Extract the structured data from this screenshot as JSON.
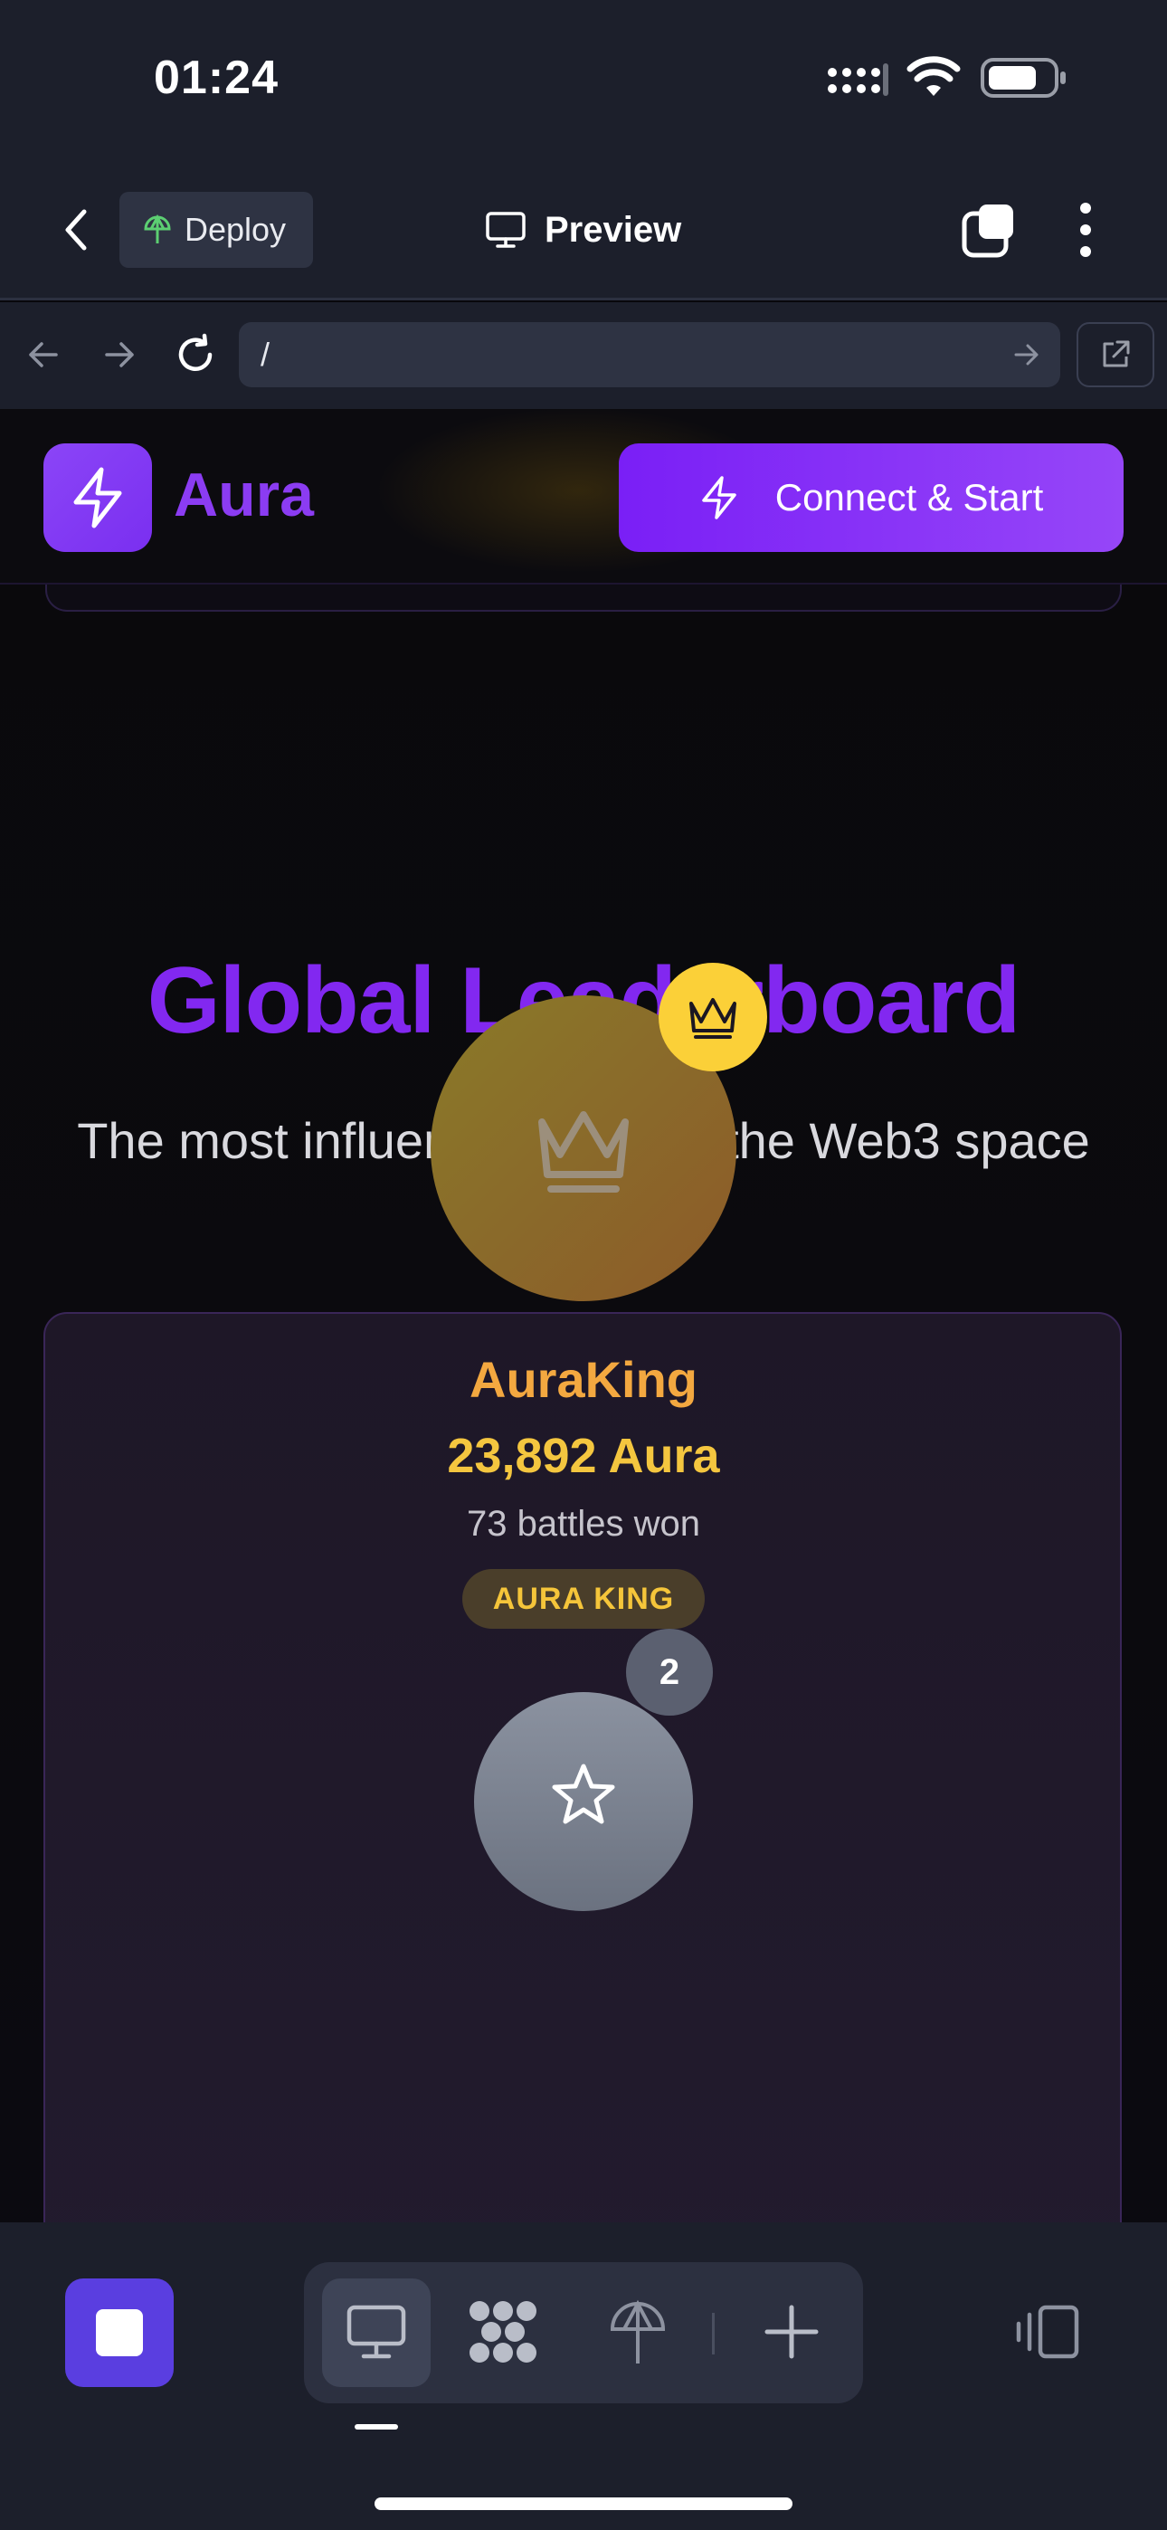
{
  "status_bar": {
    "time": "01:24"
  },
  "app_header": {
    "deploy_label": "Deploy",
    "preview_label": "Preview"
  },
  "url_bar": {
    "url": "/"
  },
  "site": {
    "brand": "Aura",
    "connect_label": "Connect & Start",
    "leaderboard_title": "Global Leaderboard",
    "leaderboard_subtitle": "The most influential KOLs in the Web3 space",
    "top_entry": {
      "name": "AuraKing",
      "score": "23,892 Aura",
      "battles": "73 battles won",
      "rank_label": "AURA KING"
    },
    "second_entry": {
      "rank": "2"
    }
  },
  "colors": {
    "accent_purple": "#8228f0",
    "gold": "#f4c63f",
    "chrome_bg": "#1c1f2b"
  }
}
